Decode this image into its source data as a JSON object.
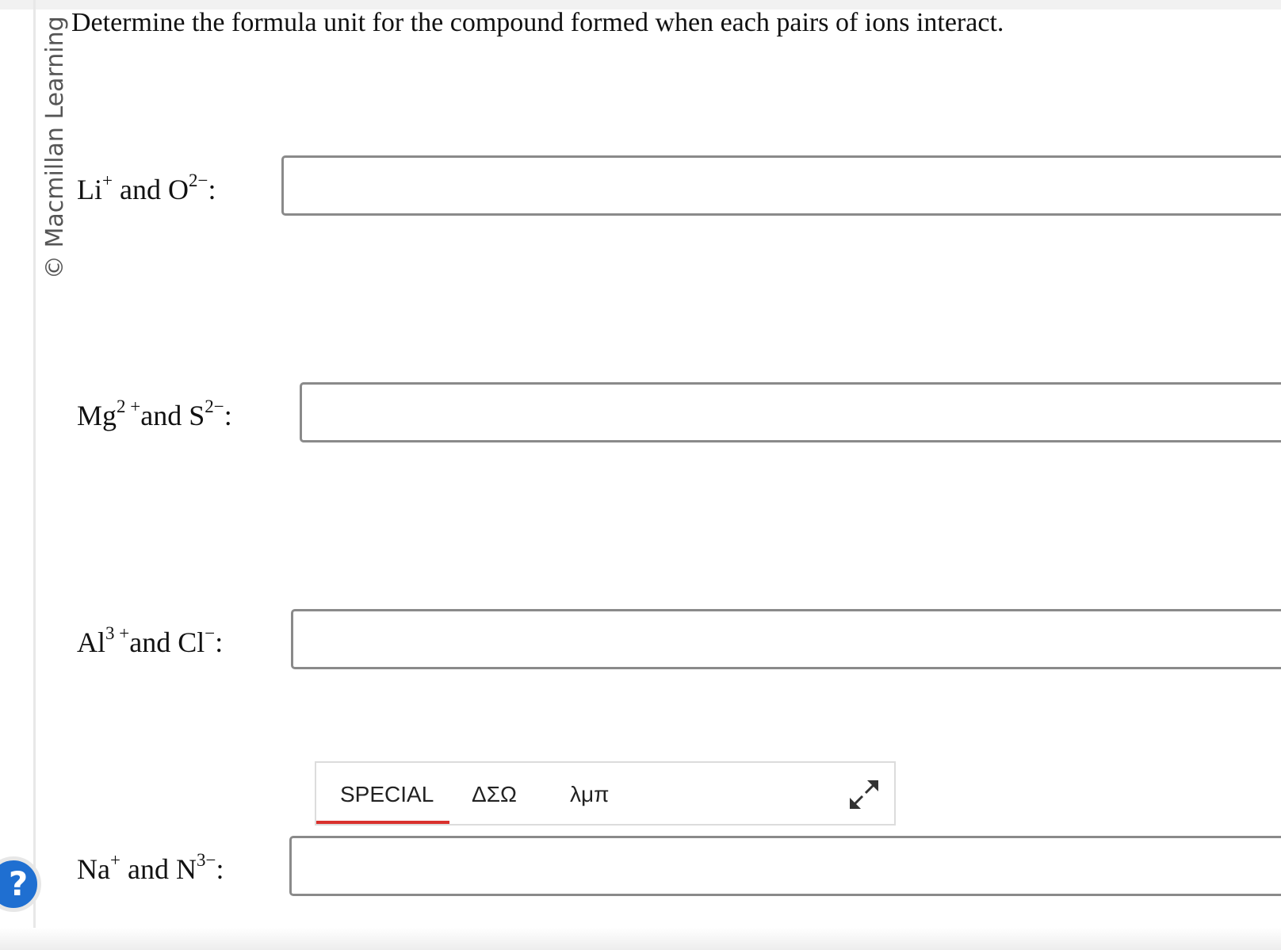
{
  "credit": "© Macmillan Learning",
  "instructions": "Determine the formula unit for the compound formed when each pairs of ions interact.",
  "questions": [
    {
      "cation": "Li",
      "cation_charge": "+",
      "joiner": "and",
      "anion": "O",
      "anion_charge": "2−",
      "colon": ":"
    },
    {
      "cation": "Mg",
      "cation_charge": "2 +",
      "joiner": "and",
      "anion": "S",
      "anion_charge": "2−",
      "colon": ":"
    },
    {
      "cation": "Al",
      "cation_charge": "3 +",
      "joiner": "and",
      "anion": "Cl",
      "anion_charge": "−",
      "colon": ":"
    },
    {
      "cation": "Na",
      "cation_charge": "+",
      "joiner": "and",
      "anion": "N",
      "anion_charge": "3−",
      "colon": ":"
    }
  ],
  "toolbar": {
    "tabs": [
      "SPECIAL",
      "ΔΣΩ",
      "λμπ"
    ],
    "active_tab": "SPECIAL",
    "active_color": "#d9302c",
    "expand_icon": "expand-arrows-icon"
  },
  "help": {
    "label": "?",
    "color": "#1f6fd1"
  }
}
